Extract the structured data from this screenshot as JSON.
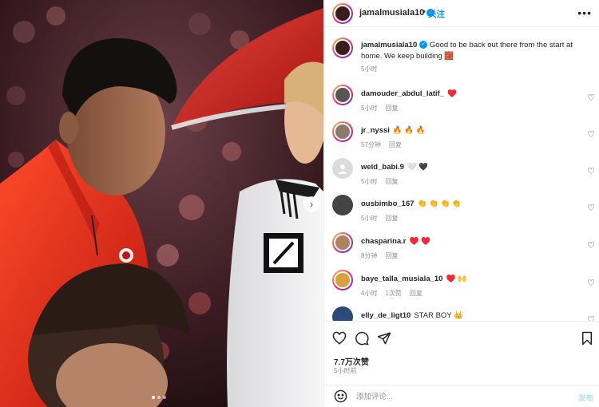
{
  "post": {
    "username": "jamalmusiala10",
    "follow_label": "关注",
    "separator": "•",
    "more_icon": "more-horizontal-icon",
    "caption": "Good to be back out there from the start at home. We keep building 🧱",
    "caption_time": "5小时",
    "likes": "7.7万次赞",
    "post_time": "5小时前",
    "comment_placeholder": "添加评论...",
    "post_button": "发布"
  },
  "comments": [
    {
      "user": "damouder_abdul_latif_",
      "text": "♥️",
      "time": "5小时",
      "reply": "回复",
      "likes": ""
    },
    {
      "user": "jr_nyssi",
      "text": "🔥 🔥 🔥",
      "time": "57分钟",
      "reply": "回复",
      "likes": ""
    },
    {
      "user": "weld_babi.9",
      "text": "🤍 🖤",
      "time": "5小时",
      "reply": "回复",
      "likes": ""
    },
    {
      "user": "ousbimbo_167",
      "text": "👏 👏 👏 👏",
      "time": "5小时",
      "reply": "回复",
      "likes": ""
    },
    {
      "user": "chasparina.r",
      "text": "♥️ ♥️",
      "time": "8分钟",
      "reply": "回复",
      "likes": ""
    },
    {
      "user": "baye_talla_musiala_10",
      "text": "♥️ 🙌",
      "time": "4小时",
      "reply": "回复",
      "likes": "1次赞"
    },
    {
      "user": "elly_de_ligt10",
      "text": "STAR BOY 👑",
      "time": "",
      "reply": "",
      "likes": ""
    }
  ],
  "colors": {
    "accent": "#0095f6",
    "jacket_red": "#d8261c",
    "text": "#262626",
    "muted": "#8e8e8e"
  },
  "carousel": {
    "total": 3,
    "current": 1
  }
}
